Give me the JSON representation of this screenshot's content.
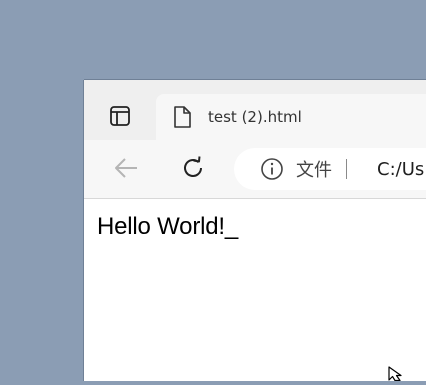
{
  "tab": {
    "title": "test (2).html"
  },
  "address_bar": {
    "label": "文件",
    "url": "C:/Us"
  },
  "page": {
    "text": "Hello World!_"
  },
  "icons": {
    "tab_actions": "tab-actions-icon",
    "favicon": "document-icon",
    "back": "back-arrow-icon",
    "refresh": "refresh-icon",
    "info": "info-icon",
    "cursor": "mouse-cursor-icon"
  },
  "colors": {
    "desktop": "#8b9db4",
    "tabstrip": "#efefef",
    "toolbar": "#f7f7f7",
    "page": "#ffffff"
  }
}
